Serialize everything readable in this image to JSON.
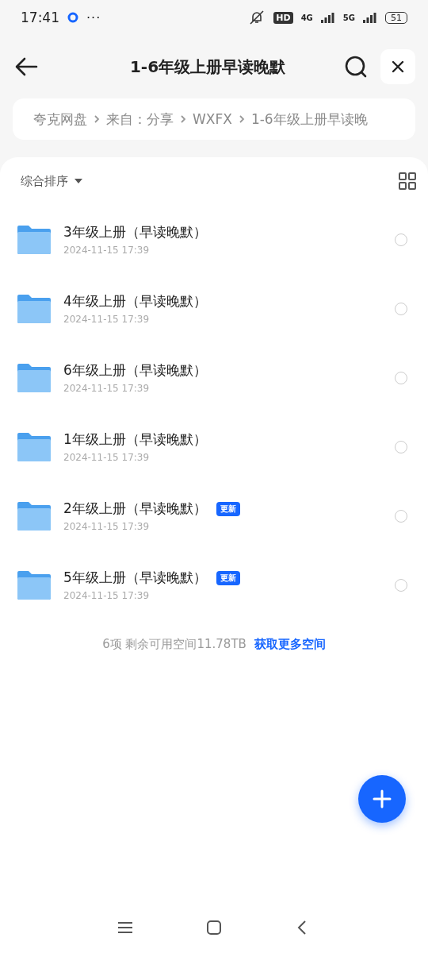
{
  "status_bar": {
    "time": "17:41",
    "more": "···",
    "hd": "HD",
    "net_1": "4G",
    "net_2": "5G",
    "battery": "51"
  },
  "header": {
    "title": "1-6年级上册早读晚默"
  },
  "breadcrumb": [
    "夸克网盘",
    "来自：分享",
    "WXFX",
    "1-6年级上册早读晚"
  ],
  "sort": {
    "label": "综合排序"
  },
  "files": [
    {
      "name": "3年级上册（早读晚默）",
      "date": "2024-11-15 17:39",
      "selected": false
    },
    {
      "name": "4年级上册（早读晚默）",
      "date": "2024-11-15 17:39",
      "selected": false
    },
    {
      "name": "6年级上册（早读晚默）",
      "date": "2024-11-15 17:39",
      "selected": false
    },
    {
      "name": "1年级上册（早读晚默）",
      "date": "2024-11-15 17:39",
      "selected": false
    },
    {
      "name": "2年级上册（早读晚默）",
      "date": "2024-11-15 17:39",
      "badge": "更新",
      "selected": false
    },
    {
      "name": "5年级上册（早读晚默）",
      "date": "2024-11-15 17:39",
      "badge": "更新",
      "selected": false
    }
  ],
  "footer": {
    "summary": "6项 剩余可用空间11.78TB",
    "link": "获取更多空间"
  }
}
